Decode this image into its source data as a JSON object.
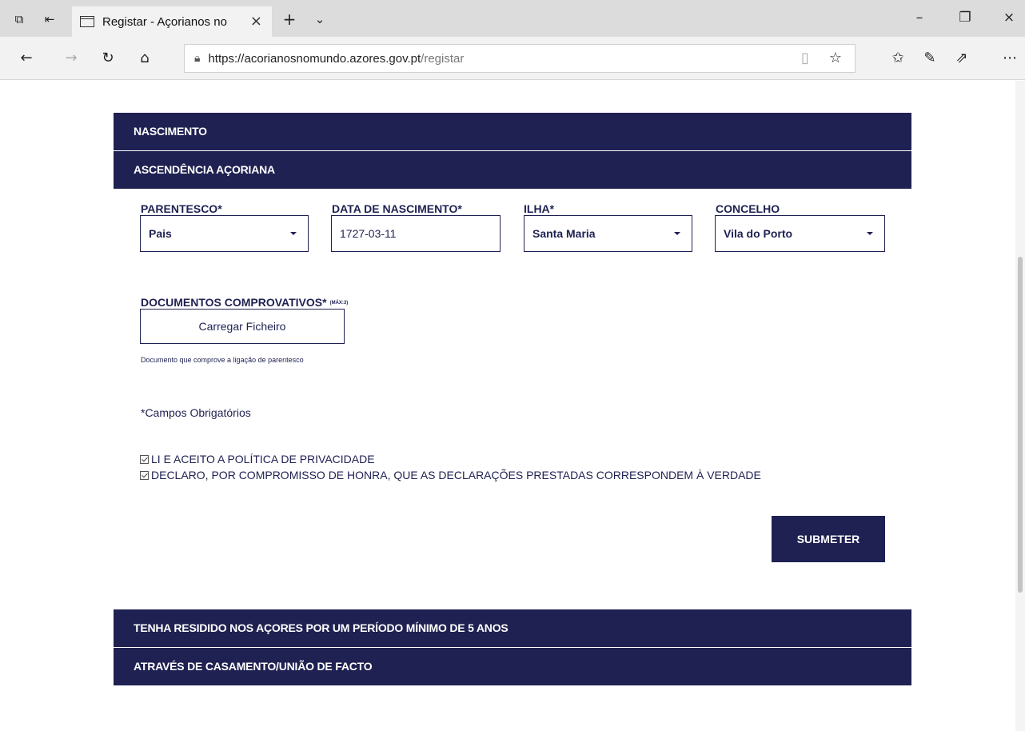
{
  "browser": {
    "tab_title": "Registar - Açorianos no",
    "url_host": "https://acorianosnomundo.azores.gov.pt",
    "url_path": "/registar"
  },
  "sections": {
    "nascimento": "NASCIMENTO",
    "ascendencia": "ASCENDÊNCIA AÇORIANA",
    "residencia": "TENHA RESIDIDO NOS AÇORES POR UM PERÍODO MÍNIMO DE 5 ANOS",
    "casamento": "ATRAVÉS DE CASAMENTO/UNIÃO DE FACTO"
  },
  "form": {
    "parentesco": {
      "label": "PARENTESCO*",
      "value": "Pais"
    },
    "data_nascimento": {
      "label": "DATA DE NASCIMENTO*",
      "value": "1727-03-11"
    },
    "ilha": {
      "label": "ILHA*",
      "value": "Santa Maria"
    },
    "concelho": {
      "label": "CONCELHO",
      "value": "Vila do Porto"
    },
    "documentos": {
      "label": "DOCUMENTOS COMPROVATIVOS*",
      "max_note": "(MÁX:3)",
      "button": "Carregar Ficheiro",
      "help": "Documento que comprove a ligação de parentesco"
    },
    "required_note": "*Campos Obrigatórios",
    "checks": [
      "LI E ACEITO A POLÍTICA DE PRIVACIDADE",
      "DECLARO, POR COMPROMISSO DE HONRA, QUE AS DECLARAÇÕES PRESTADAS CORRESPONDEM À VERDADE"
    ],
    "submit": "SUBMETER"
  }
}
